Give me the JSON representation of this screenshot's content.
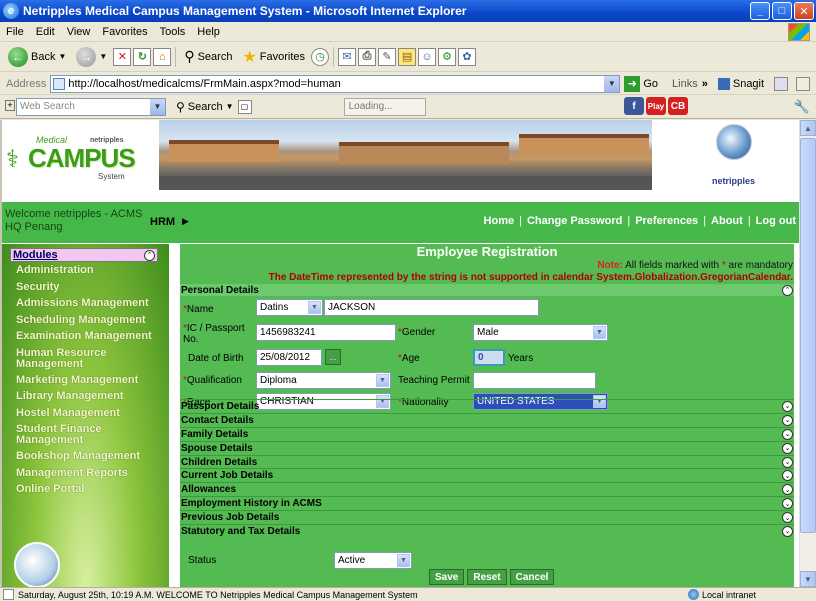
{
  "window": {
    "title": "Netripples Medical Campus Management System - Microsoft Internet Explorer"
  },
  "menu": [
    "File",
    "Edit",
    "View",
    "Favorites",
    "Tools",
    "Help"
  ],
  "toolbar": {
    "back": "Back",
    "search": "Search",
    "favorites": "Favorites"
  },
  "address": {
    "label": "Address",
    "url": "http://localhost/medicalcms/FrmMain.aspx?mod=human",
    "go": "Go",
    "links": "Links",
    "snagit": "Snagit"
  },
  "searchbar": {
    "placeholder": "Web Search",
    "search": "Search",
    "loading": "Loading..."
  },
  "social": [
    {
      "label": "f",
      "color": "#3b5998"
    },
    {
      "label": "Play",
      "color": "#d42020"
    },
    {
      "label": "CB",
      "color": "#d42020"
    }
  ],
  "logo": {
    "medical": "Medical",
    "campus": "CAMPUS",
    "brand": "netripples",
    "system": "System"
  },
  "netripples_logo": {
    "text": "netripples"
  },
  "greenbar": {
    "welcome_line1": "Welcome netripples - ACMS",
    "welcome_line2": "HQ Penang",
    "module": "HRM",
    "links": [
      "Home",
      "Change Password",
      "Preferences",
      "About",
      "Log out"
    ]
  },
  "sidebar": {
    "header": "Modules",
    "items": [
      "Administration",
      "Security",
      "Admissions Management",
      "Scheduling Management",
      "Examination Management",
      "Human Resource Management",
      "Marketing Management",
      "Library Management",
      "Hostel Management",
      "Student Finance Management",
      "Bookshop Management",
      "Management Reports",
      "Online Portal"
    ]
  },
  "form": {
    "title": "Employee Registration",
    "note_label": "Note:",
    "note_text": " All fields marked with ",
    "note_star": "*",
    "note_end": " are mandatory",
    "error": "The DateTime represented by the string is not supported in calendar System.Globalization.GregorianCalendar.",
    "personal_details": "Personal Details",
    "fields": {
      "name_label": "Name",
      "title_value": "Datins",
      "name_value": "JACKSON",
      "ic_label": "IC / Passport No.",
      "ic_value": "1456983241",
      "gender_label": "Gender",
      "gender_value": "Male",
      "dob_label": "Date of Birth",
      "dob_value": "25/08/2012",
      "cal_btn": "...",
      "age_label": "Age",
      "age_value": "0",
      "age_unit": "Years",
      "qual_label": "Qualification",
      "qual_value": "Diploma",
      "permit_label": "Teaching Permit",
      "permit_value": "",
      "race_label": "Race",
      "race_value": "CHRISTIAN",
      "nationality_label": "Nationality",
      "nationality_value": "UNITED STATES"
    },
    "sections": [
      "Passport Details",
      "Contact Details",
      "Family Details",
      "Spouse Details",
      "Children Details",
      "Current Job Details",
      "Allowances",
      "Employment History in ACMS",
      "Previous Job Details",
      "Statutory and Tax Details"
    ],
    "status_label": "Status",
    "status_value": "Active",
    "buttons": {
      "save": "Save",
      "reset": "Reset",
      "cancel": "Cancel"
    }
  },
  "statusbar": {
    "text": "Saturday, August 25th, 10:19 A.M.   WELCOME TO Netripples Medical Campus Management System",
    "zone": "Local intranet"
  }
}
